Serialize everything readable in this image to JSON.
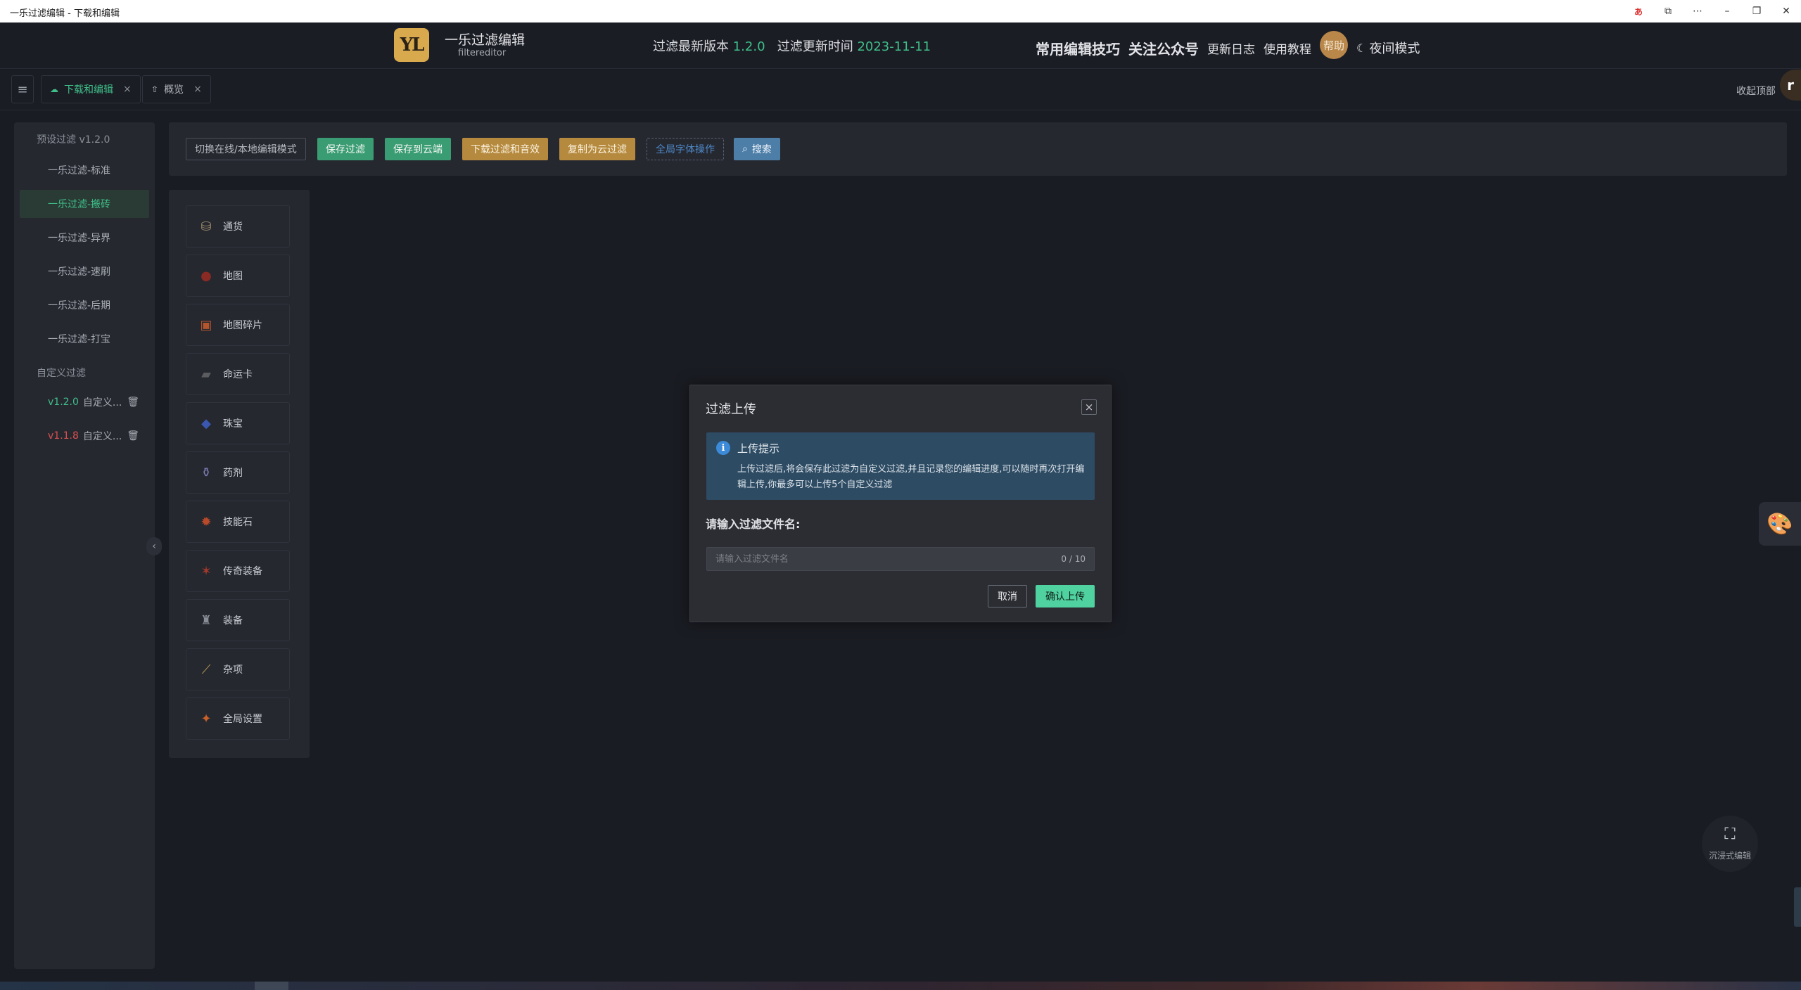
{
  "window": {
    "title": "一乐过滤编辑 - 下载和编辑",
    "ime_label": "あ",
    "controls": [
      "ime",
      "share",
      "more",
      "minimize",
      "restore",
      "close"
    ]
  },
  "header": {
    "logo_text": "YL",
    "brand_name": "一乐过滤编辑",
    "brand_sub": "filtereditor",
    "latest_version_label": "过滤最新版本",
    "latest_version": "1.2.0",
    "update_time_label": "过滤更新时间",
    "update_time": "2023-11-11",
    "links": {
      "tips": "常用编辑技巧",
      "follow": "关注公众号",
      "changelog": "更新日志",
      "tutorial": "使用教程",
      "help": "帮助",
      "night_mode": "夜间模式"
    }
  },
  "tabs": [
    {
      "label": "下载和编辑",
      "icon": "cloud-icon",
      "active": true
    },
    {
      "label": "概览",
      "icon": "cloud-upload-icon",
      "active": false
    }
  ],
  "collapse_top": "收起顶部",
  "sidebar": {
    "preset_group": "预设过滤 v1.2.0",
    "preset_items": [
      "一乐过滤-标准",
      "一乐过滤-搬砖",
      "一乐过滤-异界",
      "一乐过滤-速刷",
      "一乐过滤-后期",
      "一乐过滤-打宝"
    ],
    "active_index": 1,
    "custom_group": "自定义过滤",
    "custom_items": [
      {
        "version": "v1.2.0",
        "name": "自定义...",
        "version_color": "#3fbf8a"
      },
      {
        "version": "v1.1.8",
        "name": "自定义...",
        "version_color": "#d8504f"
      }
    ]
  },
  "toolbar": {
    "switch_mode": "切换在线/本地编辑模式",
    "save_filter": "保存过滤",
    "save_cloud": "保存到云端",
    "download_sound": "下载过滤和音效",
    "copy_cloud": "复制为云过滤",
    "global_font": "全局字体操作",
    "search": "搜索"
  },
  "categories": [
    {
      "label": "通货",
      "icon": "currency-icon"
    },
    {
      "label": "地图",
      "icon": "map-icon"
    },
    {
      "label": "地图碎片",
      "icon": "map-fragment-icon"
    },
    {
      "label": "命运卡",
      "icon": "divination-card-icon"
    },
    {
      "label": "珠宝",
      "icon": "jewel-icon"
    },
    {
      "label": "药剂",
      "icon": "flask-icon"
    },
    {
      "label": "技能石",
      "icon": "gem-icon"
    },
    {
      "label": "传奇装备",
      "icon": "unique-item-icon"
    },
    {
      "label": "装备",
      "icon": "equipment-icon"
    },
    {
      "label": "杂项",
      "icon": "misc-icon"
    },
    {
      "label": "全局设置",
      "icon": "global-settings-icon"
    }
  ],
  "modal": {
    "title": "过滤上传",
    "notice_title": "上传提示",
    "notice_body": "上传过滤后,将会保存此过滤为自定义过滤,并且记录您的编辑进度,可以随时再次打开编辑上传,你最多可以上传5个自定义过滤",
    "input_label": "请输入过滤文件名:",
    "input_placeholder": "请输入过滤文件名",
    "input_value": "",
    "counter": "0 / 10",
    "cancel": "取消",
    "confirm": "确认上传"
  },
  "floating": {
    "immersive_label": "沉浸式编辑",
    "profile_initial": "r"
  },
  "colors": {
    "accent_green": "#3fbf8a",
    "gold": "#b58a3e",
    "blue": "#4c7ea8",
    "danger": "#d8504f",
    "confirm": "#4fd1a0"
  }
}
